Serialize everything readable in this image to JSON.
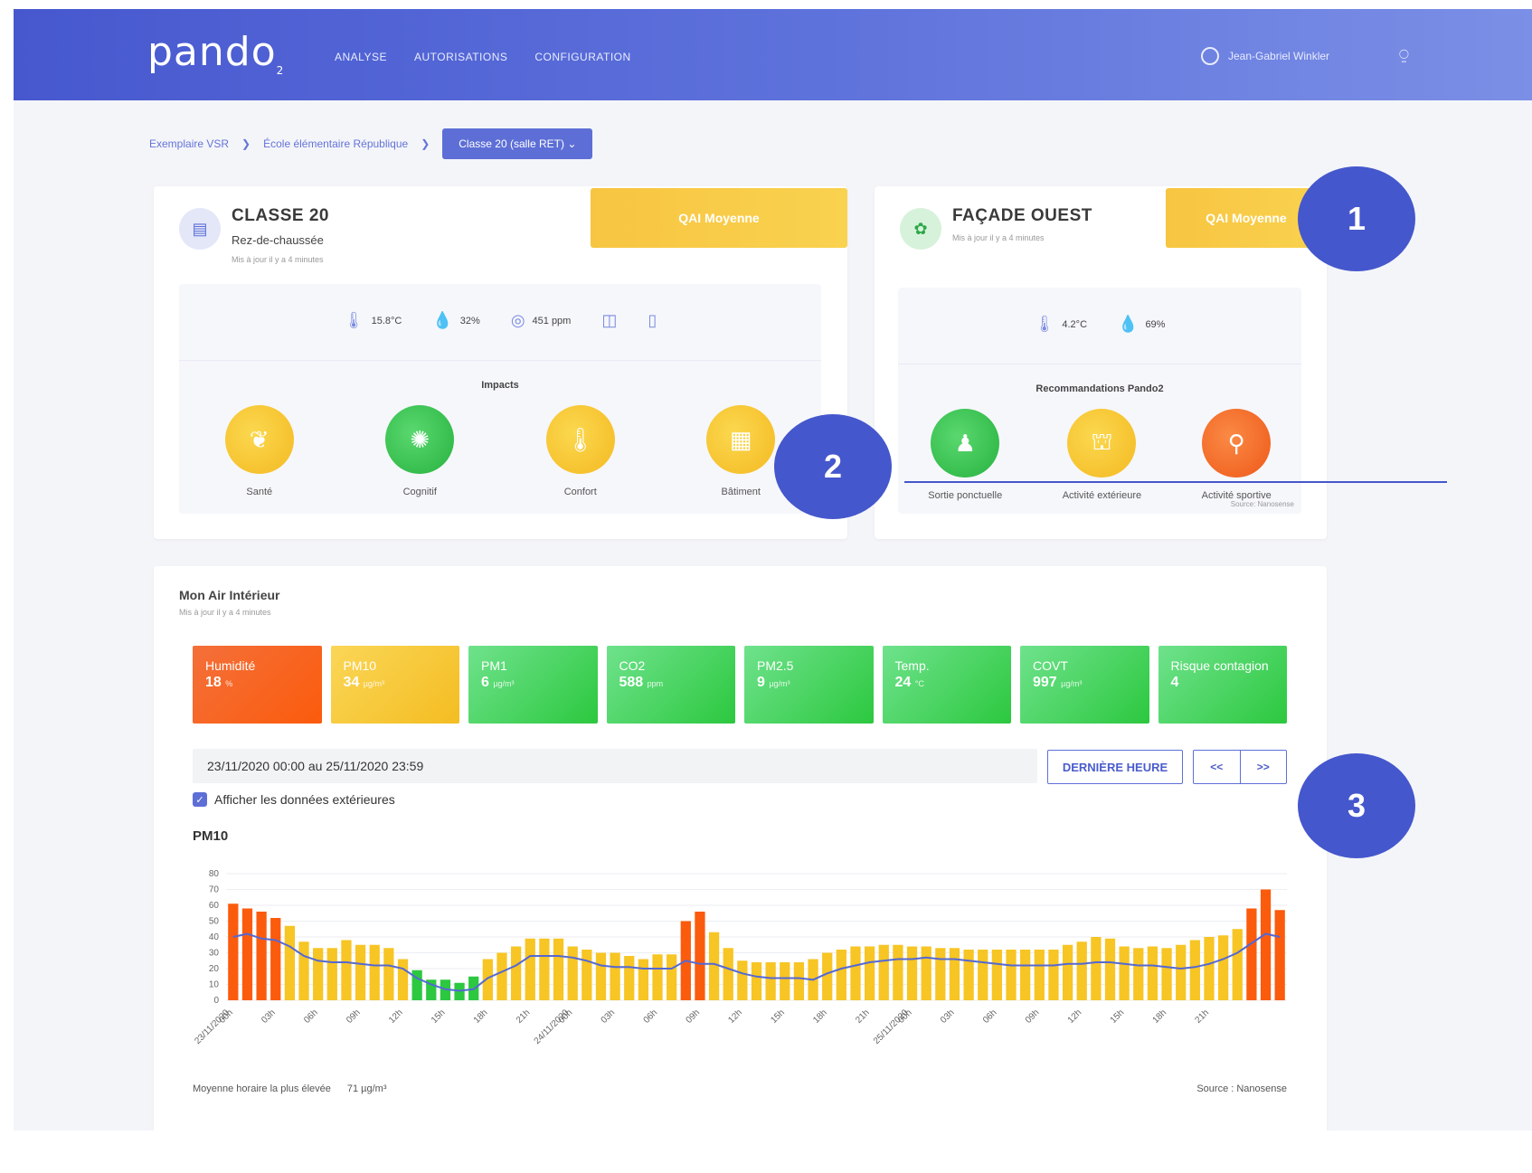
{
  "header": {
    "logo": "pando",
    "logo_sub": "2",
    "nav": [
      "ANALYSE",
      "AUTORISATIONS",
      "CONFIGURATION"
    ],
    "user_name": "Jean-Gabriel Winkler"
  },
  "breadcrumb": {
    "items": [
      "Exemplaire VSR",
      "École élémentaire République"
    ],
    "current": "Classe 20 (salle RET)"
  },
  "room_card": {
    "title": "CLASSE 20",
    "floor": "Rez-de-chaussée",
    "updated": "Mis à jour il y a 4 minutes",
    "qai": "QAI Moyenne",
    "metrics": [
      {
        "icon": "thermometer-icon",
        "value": "15.8°C"
      },
      {
        "icon": "drop-icon",
        "value": "32%"
      },
      {
        "icon": "co2-icon",
        "value": "451 ppm"
      },
      {
        "icon": "window-icon",
        "value": ""
      },
      {
        "icon": "door-icon",
        "value": ""
      }
    ],
    "impacts_title": "Impacts",
    "impacts": [
      {
        "label": "Santé",
        "color": "yellow",
        "icon": "heart-hands-icon"
      },
      {
        "label": "Cognitif",
        "color": "green",
        "icon": "brain-icon"
      },
      {
        "label": "Confort",
        "color": "yellow",
        "icon": "thermometer-icon"
      },
      {
        "label": "Bâtiment",
        "color": "yellow",
        "icon": "building-icon"
      }
    ]
  },
  "facade_card": {
    "title": "FAÇADE OUEST",
    "updated": "Mis à jour il y a 4 minutes",
    "qai": "QAI Moyenne",
    "metrics": [
      {
        "icon": "thermometer-icon",
        "value": "4.2°C"
      },
      {
        "icon": "drop-icon",
        "value": "69%"
      }
    ],
    "reco_title": "Recommandations Pando2",
    "recos": [
      {
        "label": "Sortie ponctuelle",
        "color": "green",
        "icon": "walker-icon"
      },
      {
        "label": "Activité extérieure",
        "color": "yellow",
        "icon": "playground-icon"
      },
      {
        "label": "Activité sportive",
        "color": "orange",
        "icon": "bike-icon"
      }
    ],
    "source": "Source: Nanosense"
  },
  "badges": [
    "1",
    "2",
    "3"
  ],
  "air": {
    "title": "Mon Air Intérieur",
    "updated": "Mis à jour il y a 4 minutes",
    "tiles": [
      {
        "name": "Humidité",
        "value": "18",
        "unit": "%",
        "color": "orange"
      },
      {
        "name": "PM10",
        "value": "34",
        "unit": "µg/m³",
        "color": "yellow"
      },
      {
        "name": "PM1",
        "value": "6",
        "unit": "µg/m³",
        "color": "green"
      },
      {
        "name": "CO2",
        "value": "588",
        "unit": "ppm",
        "color": "green"
      },
      {
        "name": "PM2.5",
        "value": "9",
        "unit": "µg/m³",
        "color": "green"
      },
      {
        "name": "Temp.",
        "value": "24",
        "unit": "°C",
        "color": "green"
      },
      {
        "name": "COVT",
        "value": "997",
        "unit": "µg/m³",
        "color": "green"
      },
      {
        "name": "Risque contagion",
        "value": "4",
        "unit": "",
        "color": "green"
      }
    ],
    "date_range": "23/11/2020 00:00 au 25/11/2020 23:59",
    "btn_last_hour": "DERNIÈRE HEURE",
    "btn_prev": "<<",
    "btn_next": ">>",
    "checkbox_label": "Afficher les données extérieures",
    "chart_title": "PM10",
    "footer_label": "Moyenne horaire la plus élevée",
    "footer_value": "71 µg/m³",
    "source": "Source : Nanosense"
  },
  "colors": {
    "orange": "#fb5b0c",
    "yellow": "#f7c524",
    "green": "#2cc83f",
    "line": "#5468d4"
  },
  "chart_data": {
    "type": "bar",
    "title": "PM10",
    "ylim": [
      0,
      80
    ],
    "yticks": [
      0,
      10,
      20,
      30,
      40,
      50,
      60,
      70,
      80
    ],
    "xtick_labels": [
      "00h",
      "23/11/2020",
      "03h",
      "06h",
      "09h",
      "12h",
      "15h",
      "18h",
      "21h",
      "00h",
      "24/11/2020",
      "03h",
      "06h",
      "09h",
      "12h",
      "15h",
      "18h",
      "21h",
      "00h",
      "25/11/2020",
      "03h",
      "06h",
      "09h",
      "12h",
      "15h",
      "18h",
      "21h"
    ],
    "series": [
      {
        "type": "bar",
        "values": [
          61,
          58,
          56,
          52,
          47,
          37,
          33,
          33,
          38,
          35,
          35,
          33,
          26,
          19,
          13,
          13,
          11,
          15,
          26,
          30,
          34,
          39,
          39,
          39,
          34,
          32,
          30,
          30,
          28,
          26,
          29,
          29,
          50,
          56,
          43,
          33,
          25,
          24,
          24,
          24,
          24,
          26,
          30,
          32,
          34,
          34,
          35,
          35,
          34,
          34,
          33,
          33,
          32,
          32,
          32,
          32,
          32,
          32,
          32,
          35,
          37,
          40,
          39,
          34,
          33,
          34,
          33,
          35,
          38,
          40,
          41,
          45,
          58,
          70,
          57
        ]
      },
      {
        "type": "line",
        "values": [
          40,
          42,
          39,
          38,
          34,
          28,
          25,
          24,
          24,
          23,
          22,
          22,
          20,
          14,
          10,
          7,
          6,
          7,
          14,
          18,
          22,
          28,
          28,
          28,
          27,
          25,
          22,
          21,
          21,
          20,
          20,
          20,
          25,
          23,
          23,
          20,
          17,
          15,
          14,
          14,
          14,
          13,
          17,
          20,
          22,
          24,
          25,
          26,
          26,
          27,
          26,
          26,
          25,
          24,
          23,
          22,
          22,
          22,
          22,
          23,
          23,
          24,
          24,
          23,
          22,
          22,
          21,
          20,
          21,
          23,
          26,
          30,
          36,
          42,
          40
        ]
      }
    ]
  }
}
